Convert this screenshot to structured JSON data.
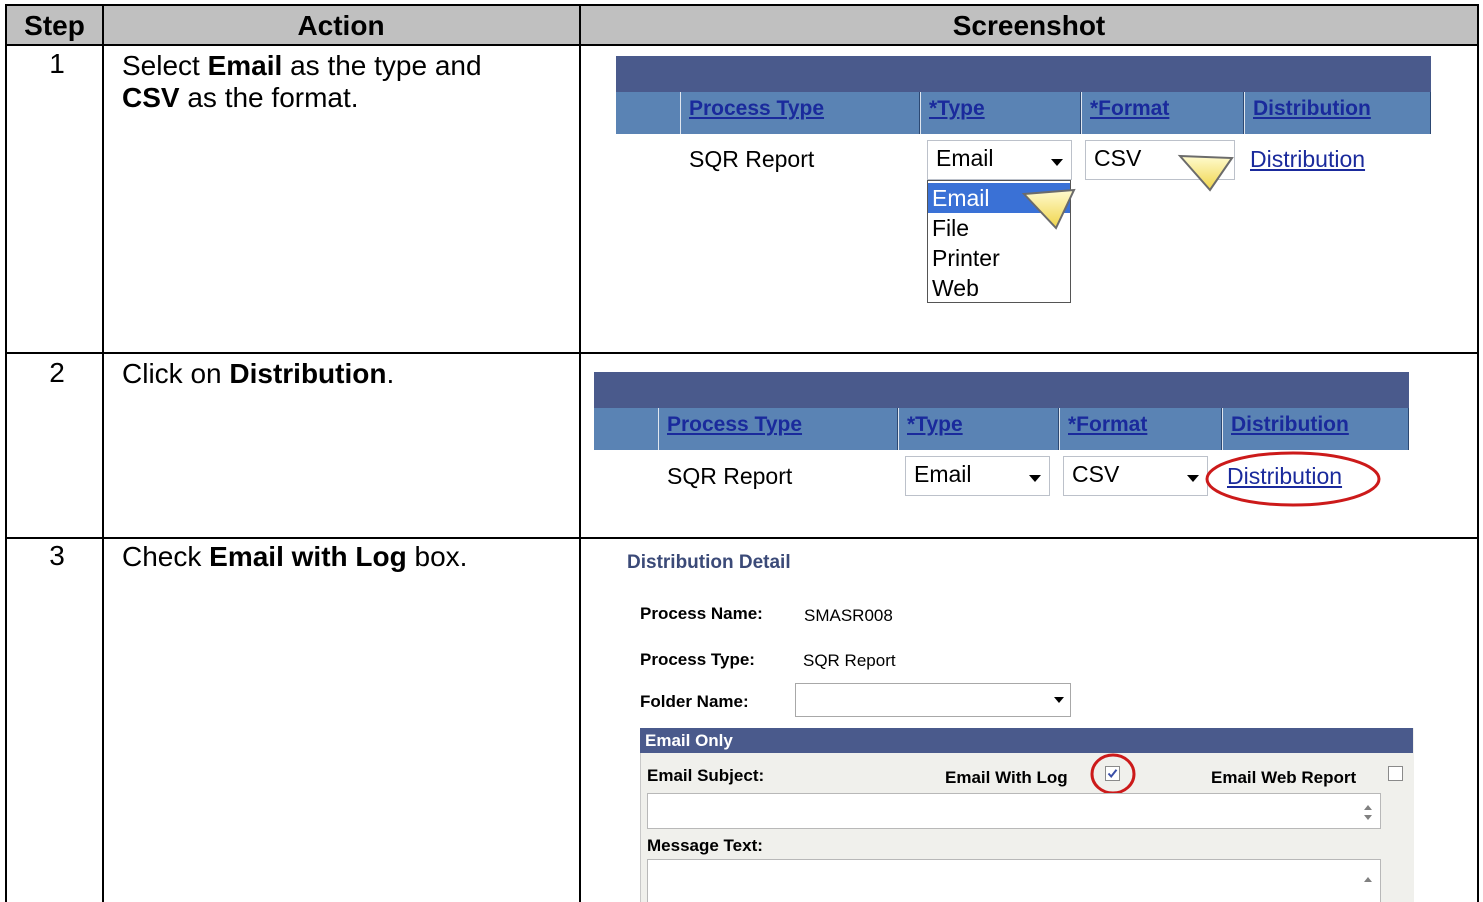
{
  "table": {
    "headers": {
      "step": "Step",
      "action": "Action",
      "screenshot": "Screenshot"
    },
    "rows": [
      {
        "step": "1",
        "action": {
          "line1_pre": "Select ",
          "line1_bold": "Email",
          "line1_post": " as the type and",
          "line2_bold": "CSV",
          "line2_post": " as the format."
        }
      },
      {
        "step": "2",
        "action": {
          "pre": "Click on ",
          "bold": "Distribution",
          "post": "."
        }
      },
      {
        "step": "3",
        "action": {
          "pre": "Check ",
          "bold": "Email with Log",
          "post": " box."
        }
      }
    ]
  },
  "shot1": {
    "headers": {
      "process_type": "Process Type",
      "type": "*Type",
      "format": "*Format",
      "distribution": "Distribution"
    },
    "row": {
      "process_type": "SQR Report",
      "type": "Email",
      "format": "CSV",
      "distribution": "Distribution"
    },
    "dropdown_options": [
      "Email",
      "File",
      "Printer",
      "Web"
    ],
    "selected_option": "Email"
  },
  "shot2": {
    "headers": {
      "process_type": "Process Type",
      "type": "*Type",
      "format": "*Format",
      "distribution": "Distribution"
    },
    "row": {
      "process_type": "SQR Report",
      "type": "Email",
      "format": "CSV",
      "distribution": "Distribution"
    }
  },
  "shot3": {
    "title": "Distribution Detail",
    "process_name_label": "Process Name:",
    "process_name_value": "SMASR008",
    "process_type_label": "Process Type:",
    "process_type_value": "SQR Report",
    "folder_name_label": "Folder Name:",
    "folder_name_value": "",
    "section_title": "Email Only",
    "email_subject_label": "Email Subject:",
    "email_with_log_label": "Email With Log",
    "email_with_log_checked": true,
    "email_web_report_label": "Email Web Report",
    "email_web_report_checked": false,
    "message_text_label": "Message Text:"
  },
  "colors": {
    "band": "#4a5a8c",
    "grid_header": "#5a83b4",
    "link": "#1a2a9c",
    "highlight_circle": "#cc1a1a",
    "selected_option": "#3a71d6",
    "table_header": "#c0c0c0"
  }
}
